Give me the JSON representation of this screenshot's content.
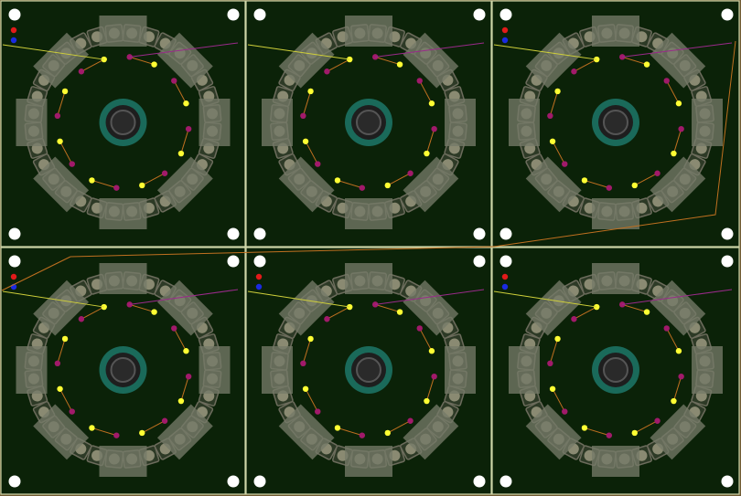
{
  "view": {
    "type": "pcb-panel-layout",
    "rows": 2,
    "cols": 3,
    "colors": {
      "background": "#6f5a33",
      "board": "#0b2208",
      "board_edge": "#cfd6a8",
      "pad": "#8a8a72",
      "pad_ring": "#6c6c5c",
      "block": "#747a68",
      "center_ring": "#1a6a5a",
      "center_inner": "#2a2a2a",
      "via_magenta": "#a11a6a",
      "via_yellow": "#ffff33",
      "trace_yellow": "#cfcf3a",
      "trace_magenta": "#9a2a8a",
      "trace_orange": "#c07020",
      "marker_red": "#e21a1a",
      "marker_blue": "#1a2ae2",
      "mount_hole": "#ffffff"
    }
  },
  "boards": [
    {
      "id": "board-1",
      "row": 0,
      "col": 0,
      "markers": [
        "red",
        "blue"
      ]
    },
    {
      "id": "board-2",
      "row": 0,
      "col": 1,
      "markers": []
    },
    {
      "id": "board-3",
      "row": 0,
      "col": 2,
      "markers": [
        "red",
        "blue"
      ]
    },
    {
      "id": "board-4",
      "row": 1,
      "col": 0,
      "markers": [
        "red",
        "blue"
      ]
    },
    {
      "id": "board-5",
      "row": 1,
      "col": 1,
      "markers": [
        "red",
        "blue"
      ]
    },
    {
      "id": "board-6",
      "row": 1,
      "col": 2,
      "markers": [
        "red",
        "blue"
      ]
    }
  ],
  "ring": {
    "pads": 32,
    "blocks": 4
  },
  "vias": {
    "inner_ring_count": 16
  }
}
